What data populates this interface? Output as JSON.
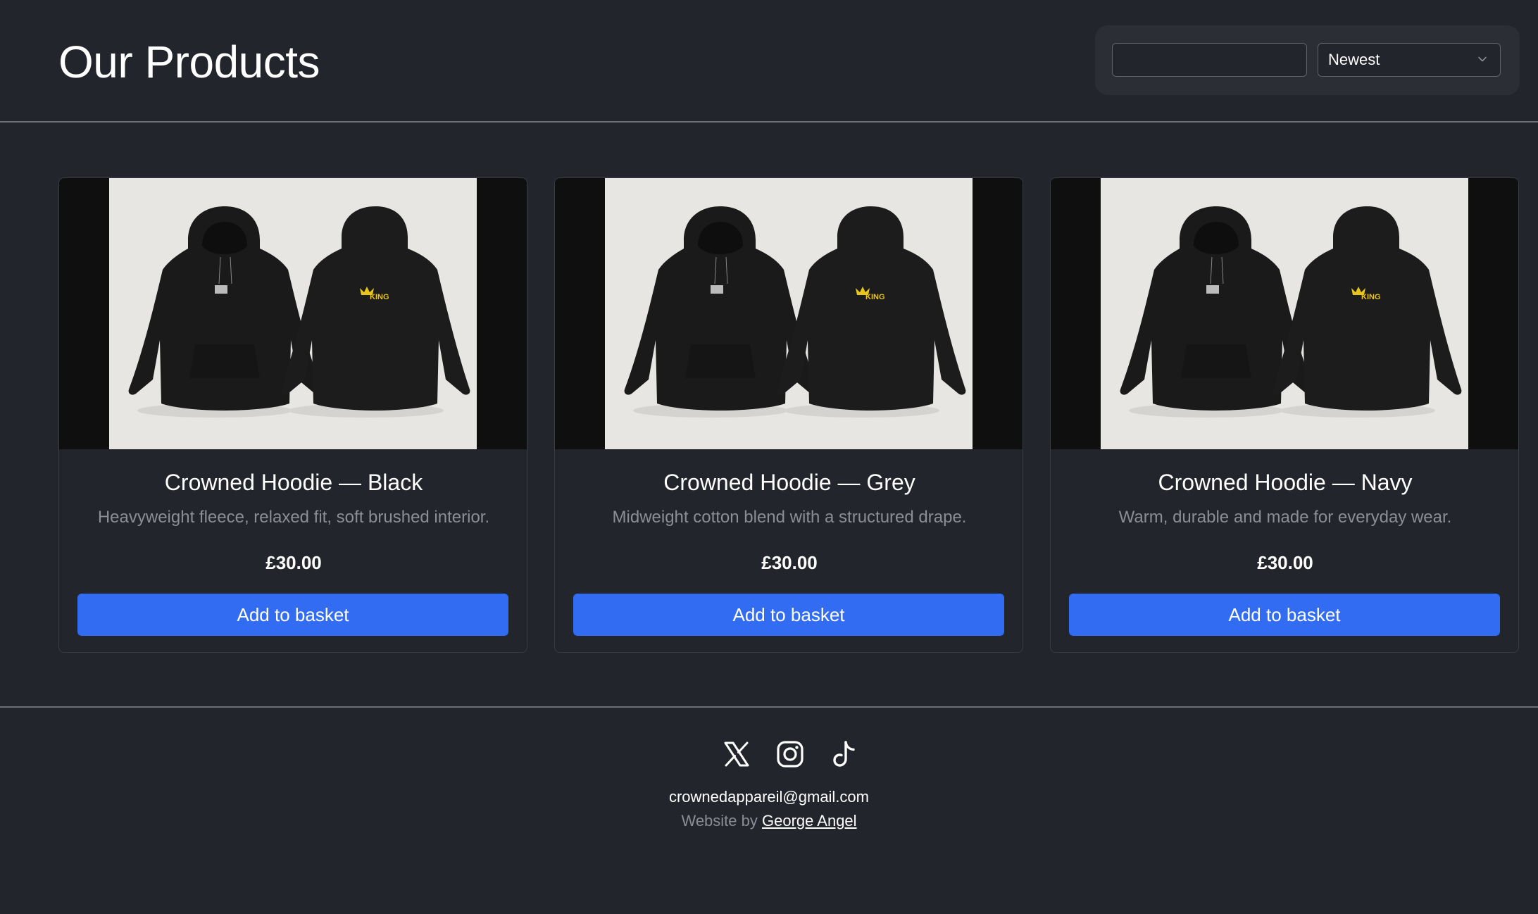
{
  "header": {
    "title": "Our Products",
    "search": {
      "value": "",
      "placeholder": ""
    },
    "sort": {
      "selected": "Newest"
    }
  },
  "products": [
    {
      "name": "Crowned Hoodie — Black",
      "description": "Heavyweight fleece, relaxed fit, soft brushed interior.",
      "price": "£30.00",
      "button_label": "Add to basket",
      "image_icon": "hoodie-pair-image",
      "image_badge_text": "KING"
    },
    {
      "name": "Crowned Hoodie — Grey",
      "description": "Midweight cotton blend with a structured drape.",
      "price": "£30.00",
      "button_label": "Add to basket",
      "image_icon": "hoodie-pair-image",
      "image_badge_text": "KING"
    },
    {
      "name": "Crowned Hoodie — Navy",
      "description": "Warm, durable and made for everyday wear.",
      "price": "£30.00",
      "button_label": "Add to basket",
      "image_icon": "hoodie-pair-image",
      "image_badge_text": "KING"
    }
  ],
  "footer": {
    "social": [
      "x-icon",
      "instagram-icon",
      "tiktok-icon"
    ],
    "email": "crownedappareil@gmail.com",
    "credit_prefix": "Website by ",
    "credit_name": "George Angel"
  },
  "colors": {
    "background": "#22252b",
    "accent": "#316cf2",
    "muted_text": "#8b8e94",
    "divider": "#6c6f75"
  }
}
